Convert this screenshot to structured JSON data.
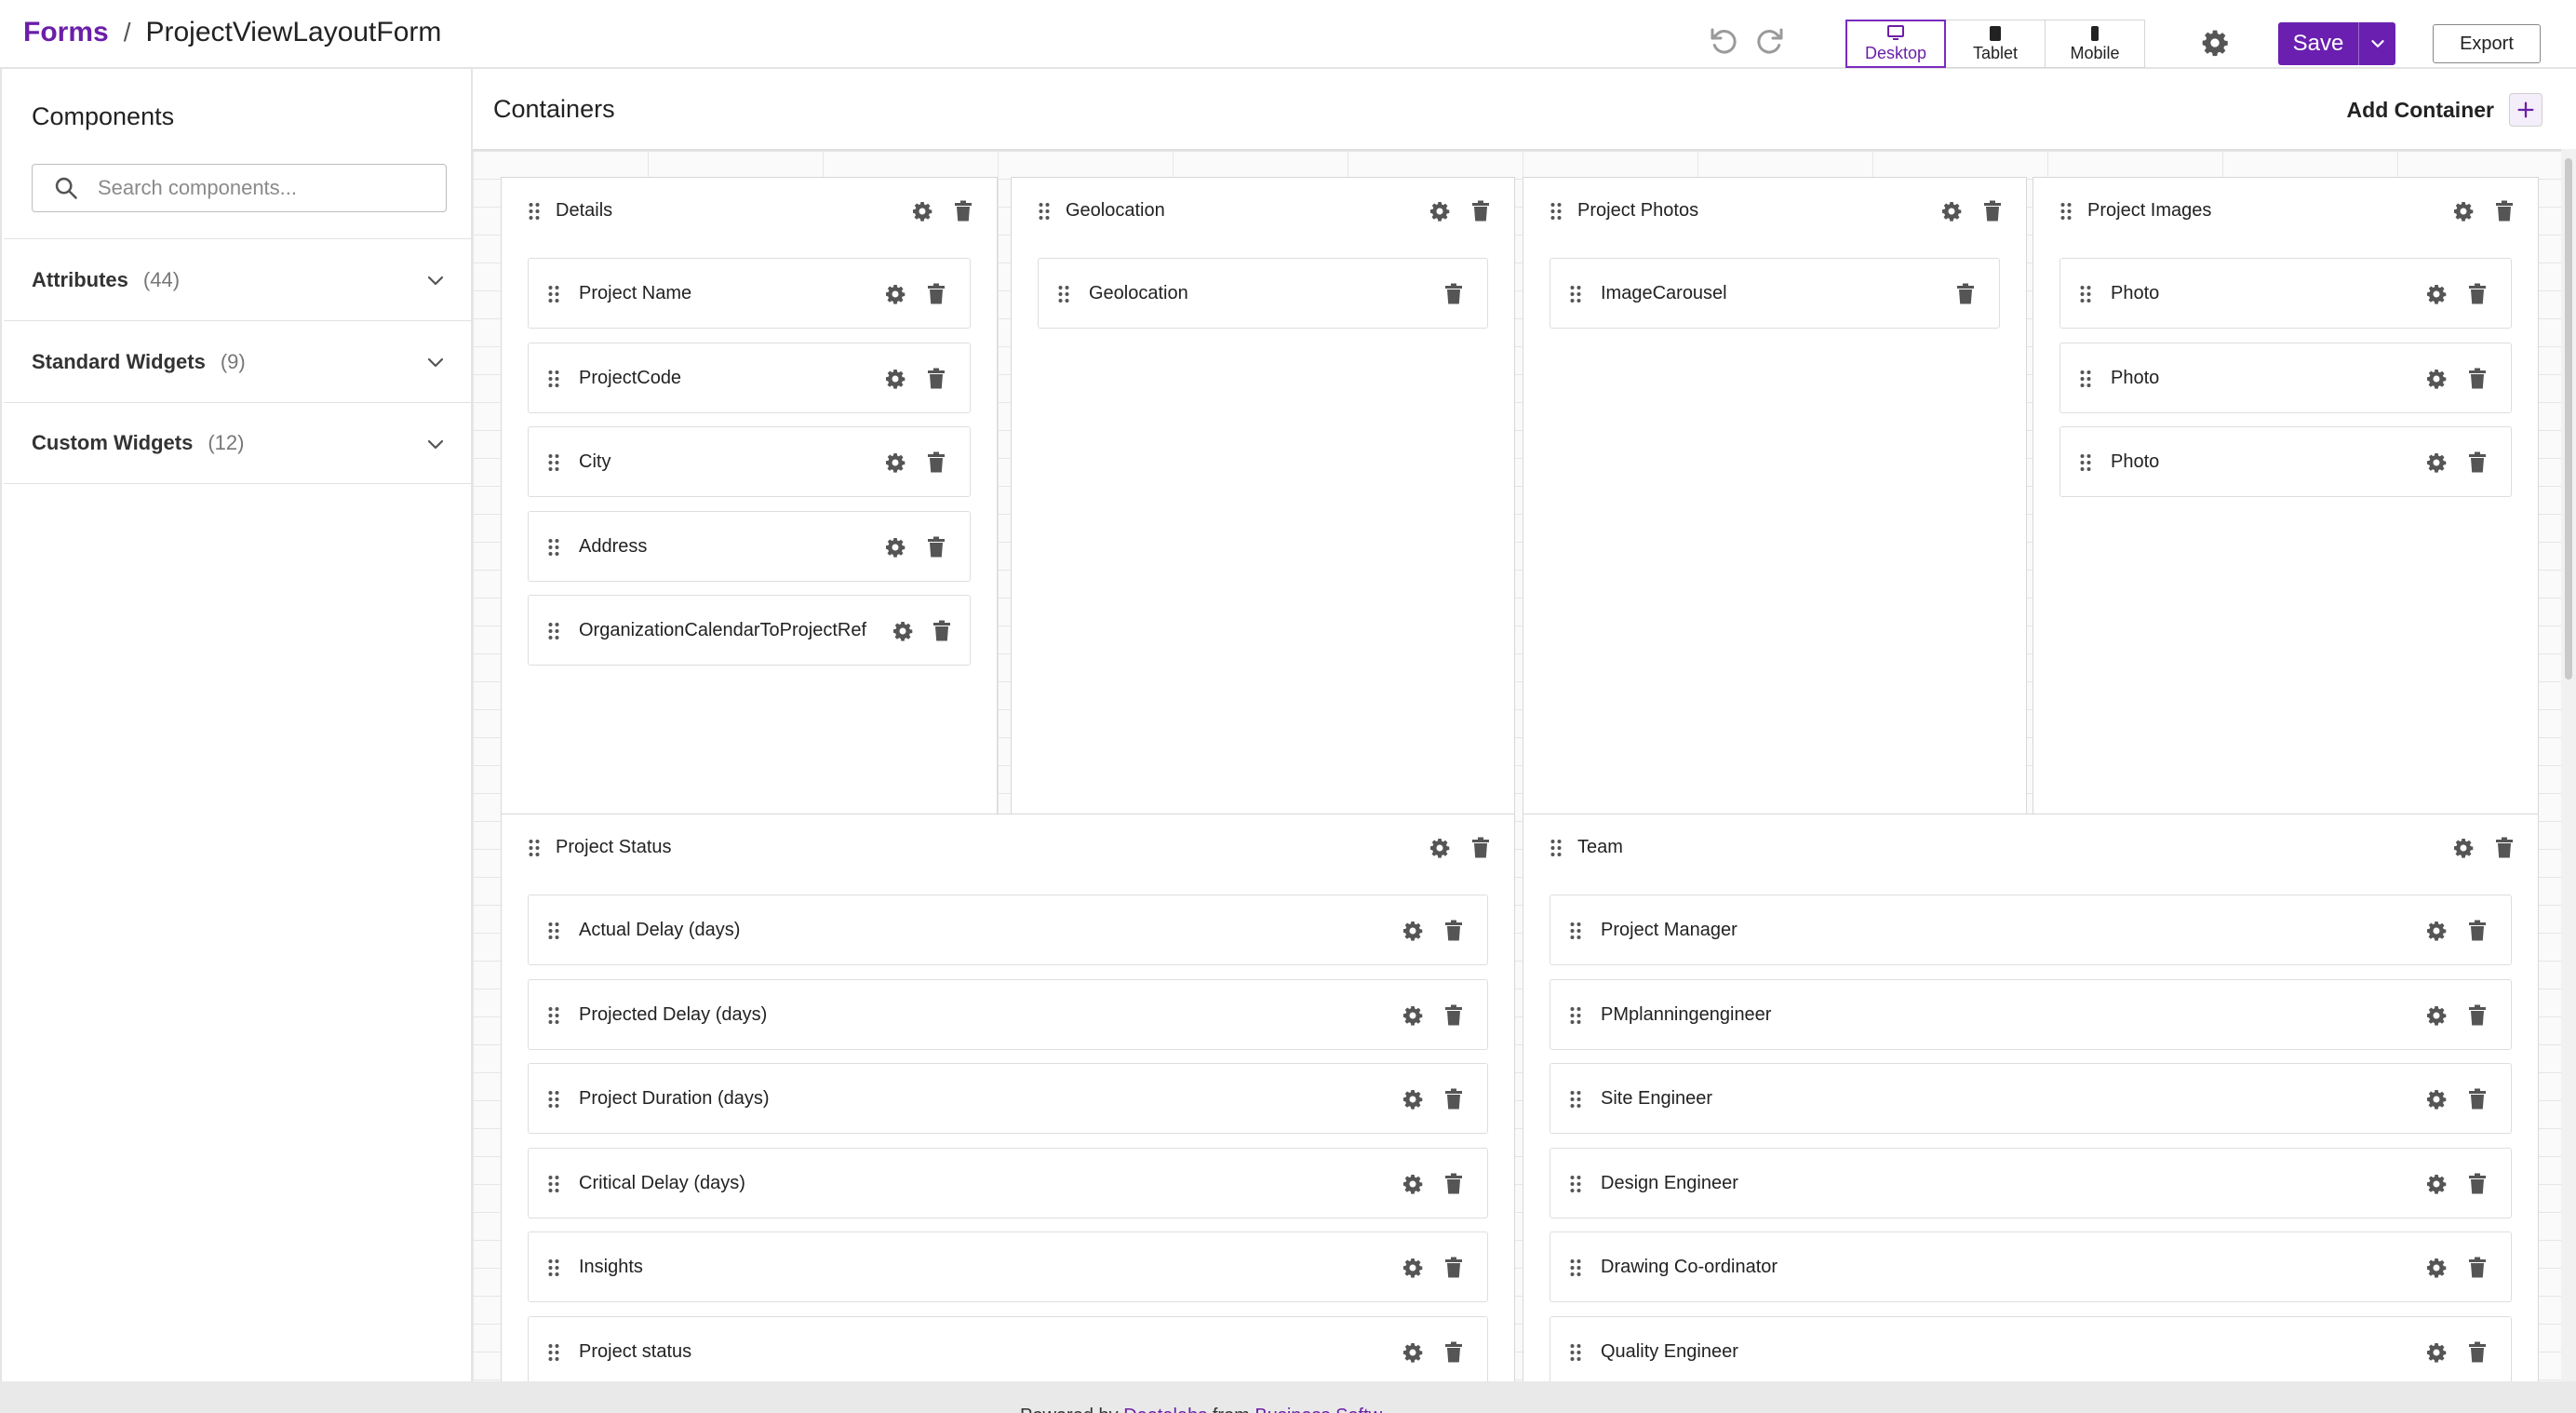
{
  "header": {
    "breadcrumb_root": "Forms",
    "breadcrumb_sep": "/",
    "breadcrumb_current": "ProjectViewLayoutForm",
    "undo_icon": "undo-icon",
    "redo_icon": "redo-icon",
    "devices": [
      {
        "label": "Desktop",
        "icon": "desktop-icon",
        "active": true
      },
      {
        "label": "Tablet",
        "icon": "tablet-icon",
        "active": false
      },
      {
        "label": "Mobile",
        "icon": "mobile-icon",
        "active": false
      }
    ],
    "save_label": "Save",
    "export_label": "Export"
  },
  "sidebar": {
    "title": "Components",
    "search_placeholder": "Search components...",
    "sections": [
      {
        "label": "Attributes",
        "count": "(44)"
      },
      {
        "label": "Standard Widgets",
        "count": "(9)"
      },
      {
        "label": "Custom Widgets",
        "count": "(12)"
      }
    ]
  },
  "main": {
    "title": "Containers",
    "add_container_label": "Add Container"
  },
  "containers": [
    {
      "title": "Details",
      "fields": [
        {
          "label": "Project Name",
          "settings": true
        },
        {
          "label": "ProjectCode",
          "settings": true
        },
        {
          "label": "City",
          "settings": true
        },
        {
          "label": "Address",
          "settings": true
        },
        {
          "label": "OrganizationCalendarToProjectRef",
          "settings": true
        }
      ]
    },
    {
      "title": "Geolocation",
      "fields": [
        {
          "label": "Geolocation",
          "settings": false
        }
      ]
    },
    {
      "title": "Project Photos",
      "fields": [
        {
          "label": "ImageCarousel",
          "settings": false
        }
      ]
    },
    {
      "title": "Project Images",
      "fields": [
        {
          "label": "Photo",
          "settings": true
        },
        {
          "label": "Photo",
          "settings": true
        },
        {
          "label": "Photo",
          "settings": true
        }
      ]
    },
    {
      "title": "Project Status",
      "fields": [
        {
          "label": "Actual Delay (days)",
          "settings": true
        },
        {
          "label": "Projected Delay (days)",
          "settings": true
        },
        {
          "label": "Project Duration (days)",
          "settings": true
        },
        {
          "label": "Critical Delay (days)",
          "settings": true
        },
        {
          "label": "Insights",
          "settings": true
        },
        {
          "label": "Project status",
          "settings": true
        }
      ]
    },
    {
      "title": "Team",
      "fields": [
        {
          "label": "Project Manager",
          "settings": true
        },
        {
          "label": "PMplanningengineer",
          "settings": true
        },
        {
          "label": "Site Engineer",
          "settings": true
        },
        {
          "label": "Design Engineer",
          "settings": true
        },
        {
          "label": "Drawing Co-ordinator",
          "settings": true
        },
        {
          "label": "Quality Engineer",
          "settings": true
        }
      ]
    }
  ],
  "footer": {
    "prefix": "Powered by",
    "brand": "Deetalabs",
    "middle": "from",
    "company": "Business Softw..."
  },
  "colors": {
    "brand": "#6a1fb0",
    "icon_gray": "#555555"
  }
}
